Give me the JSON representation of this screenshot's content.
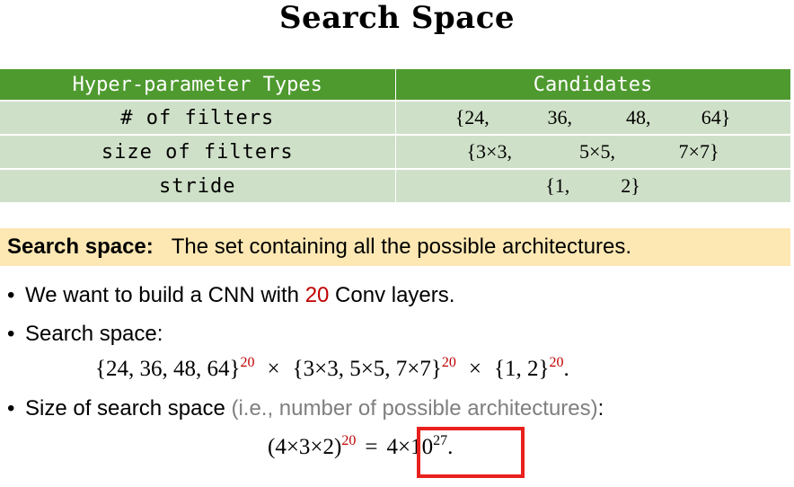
{
  "title": "Search Space",
  "table": {
    "headers": [
      "Hyper-parameter Types",
      "Candidates"
    ],
    "rows": [
      {
        "name": "# of filters",
        "candidates": [
          "{24,",
          "36,",
          "48,",
          "64}"
        ]
      },
      {
        "name": "size of filters",
        "candidates": [
          "{3×3,",
          "5×5,",
          "7×7}"
        ]
      },
      {
        "name": "stride",
        "candidates": [
          "{1,",
          "2}"
        ]
      }
    ]
  },
  "callout": {
    "label": "Search space:",
    "text": "The set containing all the possible architectures."
  },
  "bullets": {
    "b1_prefix": "We want to build a CNN with ",
    "b1_number": "20",
    "b1_suffix": " Conv layers.",
    "b2": "Search space:",
    "b3_main": "Size of search space ",
    "b3_paren": "(i.e., number of possible architectures)",
    "b3_colon": ":"
  },
  "formula1": {
    "set1": "{24, 36, 48, 64}",
    "exp1": "20",
    "times1": "×",
    "set2": "{3×3, 5×5, 7×7}",
    "exp2": "20",
    "times2": "×",
    "set3": "{1, 2}",
    "exp3": "20",
    "end": "."
  },
  "formula2": {
    "base": "(4×3×2)",
    "exp": "20",
    "equals": "=",
    "result_base": "4×10",
    "result_exp": "27",
    "end": "."
  },
  "colors": {
    "header_green": "#4e9a2f",
    "row_green": "#cfe0c8",
    "callout_bg": "#fde8b3",
    "accent_red": "#c00000",
    "box_red": "#e8211d",
    "gray_text": "#7f7f7f"
  }
}
